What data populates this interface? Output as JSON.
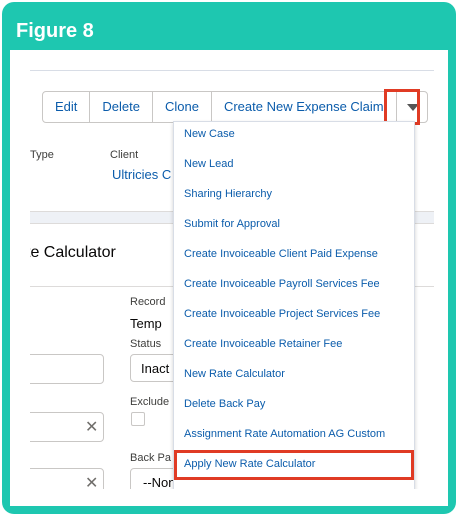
{
  "figure": {
    "title": "Figure 8"
  },
  "toolbar": {
    "buttons": [
      "Edit",
      "Delete",
      "Clone",
      "Create New Expense Claim"
    ]
  },
  "record": {
    "type_label": "Type",
    "client_label": "Client",
    "client_value": "Ultricies C"
  },
  "card": {
    "title": "te Calculator",
    "record_label": "Record",
    "record_value": "Temp",
    "status_label": "Status",
    "status_value": "Inact",
    "exclude_label": "Exclude",
    "backpay_label": "Back Pa",
    "backpay_value": "--None--"
  },
  "menu": {
    "items": [
      "New Case",
      "New Lead",
      "Sharing Hierarchy",
      "Submit for Approval",
      "Create Invoiceable Client Paid Expense",
      "Create Invoiceable Payroll Services Fee",
      "Create Invoiceable Project Services Fee",
      "Create Invoiceable Retainer Fee",
      "New Rate Calculator",
      "Delete Back Pay",
      "Assignment Rate Automation AG Custom",
      "Apply New Rate Calculator"
    ]
  },
  "colors": {
    "frame": "#1ec7b0",
    "highlight": "#e03b24",
    "link": "#0b5cab"
  }
}
